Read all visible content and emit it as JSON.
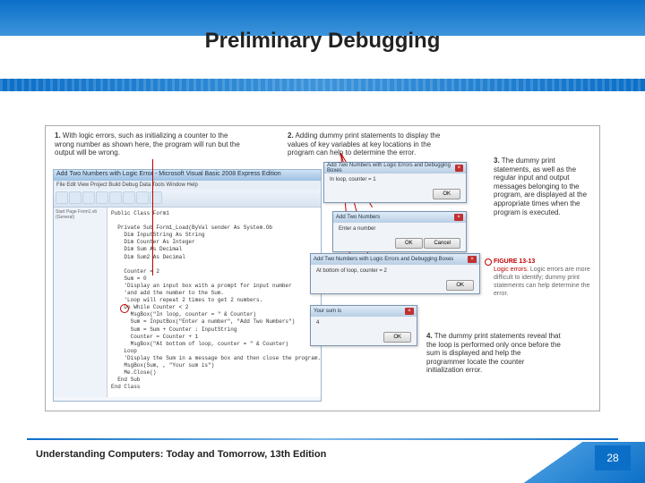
{
  "title": "Preliminary Debugging",
  "callouts": {
    "c1": {
      "num": "1.",
      "text": "With logic errors, such as initializing a counter to the wrong number as shown here, the program will run but the output will be wrong."
    },
    "c2": {
      "num": "2.",
      "text": "Adding dummy print statements to display the values of key variables at key locations in the program can help to determine the error."
    },
    "c3": {
      "num": "3.",
      "text": "The dummy print statements, as well as the regular input and output messages belonging to the program, are displayed at the appropriate times when the program is executed."
    },
    "c4": {
      "num": "4.",
      "text": "The dummy print statements reveal that the loop is performed only once before the sum is displayed and help the programmer locate the counter initialization error."
    }
  },
  "ide": {
    "title": "Add Two Numbers with Logic Error - Microsoft Visual Basic 2008 Express Edition",
    "menu": "File  Edit  View  Project  Build  Debug  Data  Tools  Window  Help",
    "side": "Start Page  Form1.vb  (General)",
    "code_lines": [
      "Public Class Form1",
      "",
      "  Private Sub Form1_Load(ByVal sender As System.Ob",
      "    Dim InputString As String",
      "    Dim Counter As Integer",
      "    Dim Sum As Decimal",
      "    Dim Sum2 As Decimal",
      "",
      "    Counter = 2",
      "    Sum = 0",
      "    'Display an input box with a prompt for input number",
      "    'and add the number to the Sum.",
      "    'Loop will repeat 2 times to get 2 numbers.",
      "    Do While Counter < 2",
      "      MsgBox(\"In loop, counter = \" & Counter)",
      "      Sum = InputBox(\"Enter a number\", \"Add Two Numbers\")",
      "      Sum = Sum + Counter : InputString",
      "      Counter = Counter + 1",
      "      MsgBox(\"At bottom of loop, counter = \" & Counter)",
      "    Loop",
      "    'Display the Sum in a message box and then close the program.",
      "    MsgBox(Sum, , \"Your sum is\")",
      "    Me.Close()",
      "  End Sub",
      "End Class"
    ]
  },
  "dialogs": {
    "d1": {
      "title": "Add Two Numbers with Logic Errors and Debugging Boxes",
      "body": "In loop, counter = 1",
      "ok": "OK"
    },
    "d2": {
      "title": "Add Two Numbers",
      "body": "Enter a number",
      "ok": "OK",
      "cancel": "Cancel"
    },
    "d3": {
      "title": "Add Two Numbers with Logic Errors and Debugging Boxes",
      "body": "At bottom of loop, counter = 2",
      "ok": "OK"
    },
    "d4": {
      "title": "Your sum is",
      "body": "4",
      "ok": "OK"
    }
  },
  "figure_label": {
    "num": "FIGURE 13-13",
    "title": "Logic errors.",
    "caption": "Logic errors are more difficult to identify; dummy print statements can help determine the error."
  },
  "footer": "Understanding Computers: Today and Tomorrow, 13th Edition",
  "page": "28"
}
